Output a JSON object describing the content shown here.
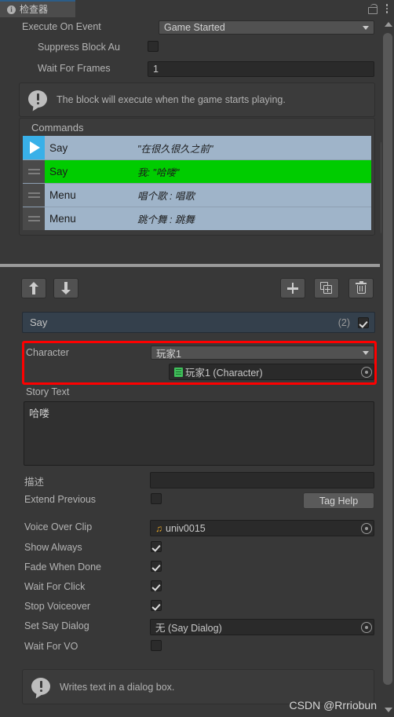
{
  "window": {
    "tab_label": "检查器",
    "info_icon": "info-icon",
    "lock_icon": "lock-icon",
    "menu_icon": "kebab-menu-icon"
  },
  "block": {
    "execute_on_event": {
      "label": "Execute On Event",
      "value": "Game Started"
    },
    "suppress_block_auto": {
      "label": "Suppress Block Au",
      "checked": false
    },
    "wait_for_frames": {
      "label": "Wait For Frames",
      "value": "1"
    },
    "help": "The block will execute when the game starts playing."
  },
  "commands": {
    "header": "Commands",
    "items": [
      {
        "name": "Say",
        "summary": "\"在很久很久之前\"",
        "state": "selected",
        "handle": "play-icon"
      },
      {
        "name": "Say",
        "summary": "我: \"哈喽\"",
        "state": "executing",
        "handle": "drag-handle-icon"
      },
      {
        "name": "Menu",
        "summary": "唱个歌 : 唱歌",
        "state": "selected",
        "handle": "drag-handle-icon"
      },
      {
        "name": "Menu",
        "summary": "跳个舞 : 跳舞",
        "state": "selected",
        "handle": "drag-handle-icon"
      }
    ]
  },
  "toolbar": {
    "move_up": "move-up-button",
    "move_down": "move-down-button",
    "add": "add-command-button",
    "duplicate": "duplicate-command-button",
    "delete": "delete-command-button"
  },
  "command_detail": {
    "title": "Say",
    "count": "(2)",
    "enabled": true,
    "character": {
      "label": "Character",
      "value": "玩家1",
      "object": "玩家1 (Character)"
    },
    "story_text": {
      "label": "Story Text",
      "value": "哈喽"
    },
    "description": {
      "label": "描述",
      "value": ""
    },
    "extend_previous": {
      "label": "Extend Previous",
      "checked": false
    },
    "tag_help": "Tag Help",
    "voice_over_clip": {
      "label": "Voice Over Clip",
      "value": "univ0015"
    },
    "show_always": {
      "label": "Show Always",
      "checked": true
    },
    "fade_when_done": {
      "label": "Fade When Done",
      "checked": true
    },
    "wait_for_click": {
      "label": "Wait For Click",
      "checked": true
    },
    "stop_voiceover": {
      "label": "Stop Voiceover",
      "checked": true
    },
    "set_say_dialog": {
      "label": "Set Say Dialog",
      "value": "无 (Say Dialog)"
    },
    "wait_for_vo": {
      "label": "Wait For VO",
      "checked": false
    },
    "footer_help": "Writes text in a dialog box."
  },
  "watermark": "CSDN @Rrriobun",
  "colors": {
    "accent_blue": "#2c5d87",
    "selection": "#9fb4c9",
    "executing_green": "#00cc00",
    "highlight_red": "#fe0000",
    "marker_orange": "#ff8a00"
  }
}
